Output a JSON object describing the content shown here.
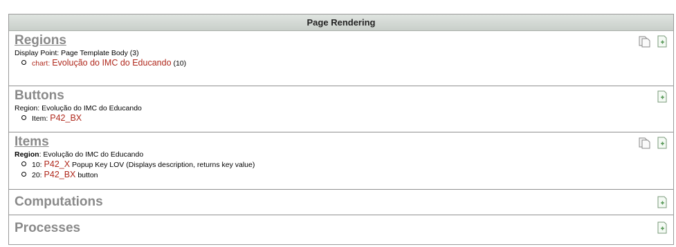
{
  "panel": {
    "title": "Page Rendering"
  },
  "regions": {
    "title": "Regions",
    "display_point": "Display Point: Page Template Body (3)",
    "item_type": "chart:",
    "item_name": "Evolução do IMC do Educando",
    "item_seq": "(10)"
  },
  "buttons": {
    "title": "Buttons",
    "region_line": "Region: Evolução do IMC do Educando",
    "item_prefix": "Item:",
    "item_name": "P42_BX"
  },
  "items": {
    "title": "Items",
    "region_label": "Region",
    "region_value": ": Evolução do IMC do Educando",
    "rows": [
      {
        "seq": "10:",
        "name": "P42_X",
        "desc": "Popup Key LOV (Displays description, returns key value)"
      },
      {
        "seq": "20:",
        "name": "P42_BX",
        "desc": "button"
      }
    ]
  },
  "computations": {
    "title": "Computations"
  },
  "processes": {
    "title": "Processes"
  },
  "icons": {
    "copy": "copy-icon",
    "create": "create-icon"
  }
}
